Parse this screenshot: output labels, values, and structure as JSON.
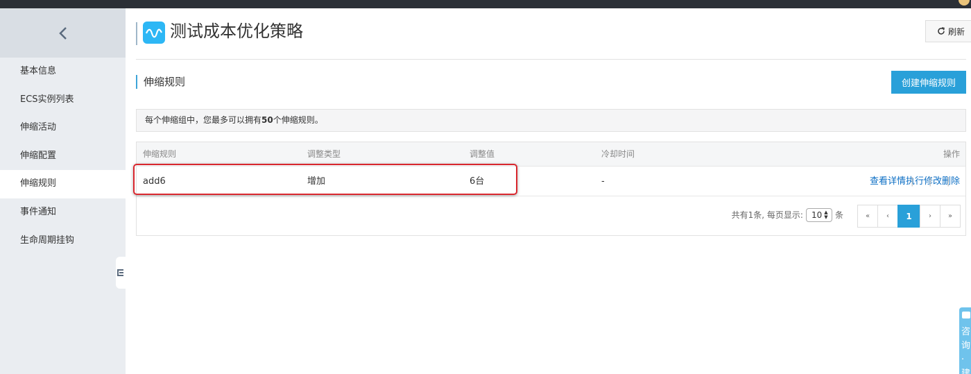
{
  "window": {
    "title": "测试成本优化策略"
  },
  "sidebar": {
    "items": [
      {
        "label": "基本信息"
      },
      {
        "label": "ECS实例列表"
      },
      {
        "label": "伸缩活动"
      },
      {
        "label": "伸缩配置"
      },
      {
        "label": "伸缩规则",
        "active": true
      },
      {
        "label": "事件通知"
      },
      {
        "label": "生命周期挂钩"
      }
    ]
  },
  "header": {
    "title": "测试成本优化策略",
    "refresh_label": "刷新"
  },
  "section": {
    "title": "伸缩规则",
    "create_label": "创建伸缩规则"
  },
  "notice": {
    "prefix": "每个伸缩组中，您最多可以拥有",
    "count": "50",
    "suffix": "个伸缩规则。"
  },
  "table": {
    "headers": [
      "伸缩规则",
      "调整类型",
      "调整值",
      "冷却时间",
      "操作"
    ],
    "rows": [
      {
        "rule": "add6",
        "type": "增加",
        "value": "6台",
        "cooldown": "-",
        "actions": [
          "查看详情",
          "执行",
          "修改",
          "删除"
        ]
      }
    ]
  },
  "pagination": {
    "total_text": "共有1条, 每页显示:",
    "page_size": "10",
    "unit": "条",
    "first": "«",
    "prev": "‹",
    "current": "1",
    "next": "›",
    "last": "»"
  },
  "float_tab": {
    "text": "咨询·建"
  },
  "colors": {
    "primary": "#29a0d9",
    "highlight": "#d9272e",
    "link": "#0b6ec4"
  }
}
